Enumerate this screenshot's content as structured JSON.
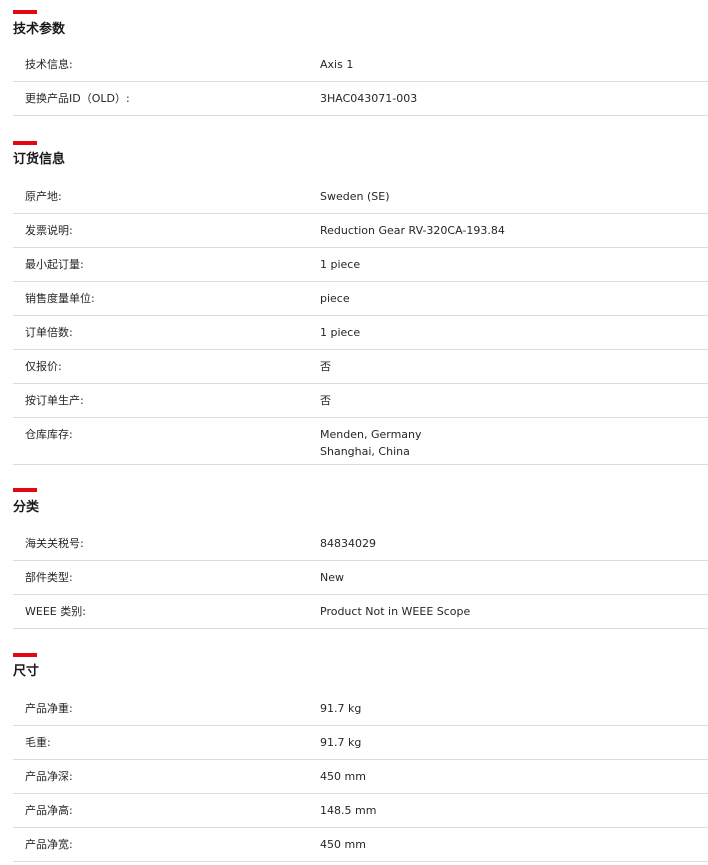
{
  "sections": [
    {
      "title": "技术参数",
      "rows": [
        {
          "label": "技术信息:",
          "value": "Axis 1"
        },
        {
          "label": "更换产品ID（OLD）:",
          "value": "3HAC043071-003"
        }
      ]
    },
    {
      "title": "订货信息",
      "rows": [
        {
          "label": "原产地:",
          "value": "Sweden (SE)"
        },
        {
          "label": "发票说明:",
          "value": "Reduction Gear RV-320CA-193.84"
        },
        {
          "label": "最小起订量:",
          "value": "1 piece"
        },
        {
          "label": "销售度量单位:",
          "value": "piece"
        },
        {
          "label": "订单倍数:",
          "value": "1 piece"
        },
        {
          "label": "仅报价:",
          "value": "否"
        },
        {
          "label": "按订单生产:",
          "value": "否"
        },
        {
          "label": "仓库库存:",
          "values": [
            "Menden, Germany",
            "Shanghai, China"
          ]
        }
      ]
    },
    {
      "title": "分类",
      "rows": [
        {
          "label": "海关关税号:",
          "value": "84834029"
        },
        {
          "label": "部件类型:",
          "value": "New"
        },
        {
          "label": "WEEE 类别:",
          "value": "Product Not in WEEE Scope"
        }
      ]
    },
    {
      "title": "尺寸",
      "rows": [
        {
          "label": "产品净重:",
          "value": "91.7 kg"
        },
        {
          "label": "毛重:",
          "value": "91.7 kg"
        },
        {
          "label": "产品净深:",
          "value": "450 mm"
        },
        {
          "label": "产品净高:",
          "value": "148.5 mm"
        },
        {
          "label": "产品净宽:",
          "value": "450 mm"
        }
      ]
    }
  ],
  "colors": {
    "accent": "#e30613",
    "divider": "#dcdcdc",
    "text": "#262626"
  }
}
